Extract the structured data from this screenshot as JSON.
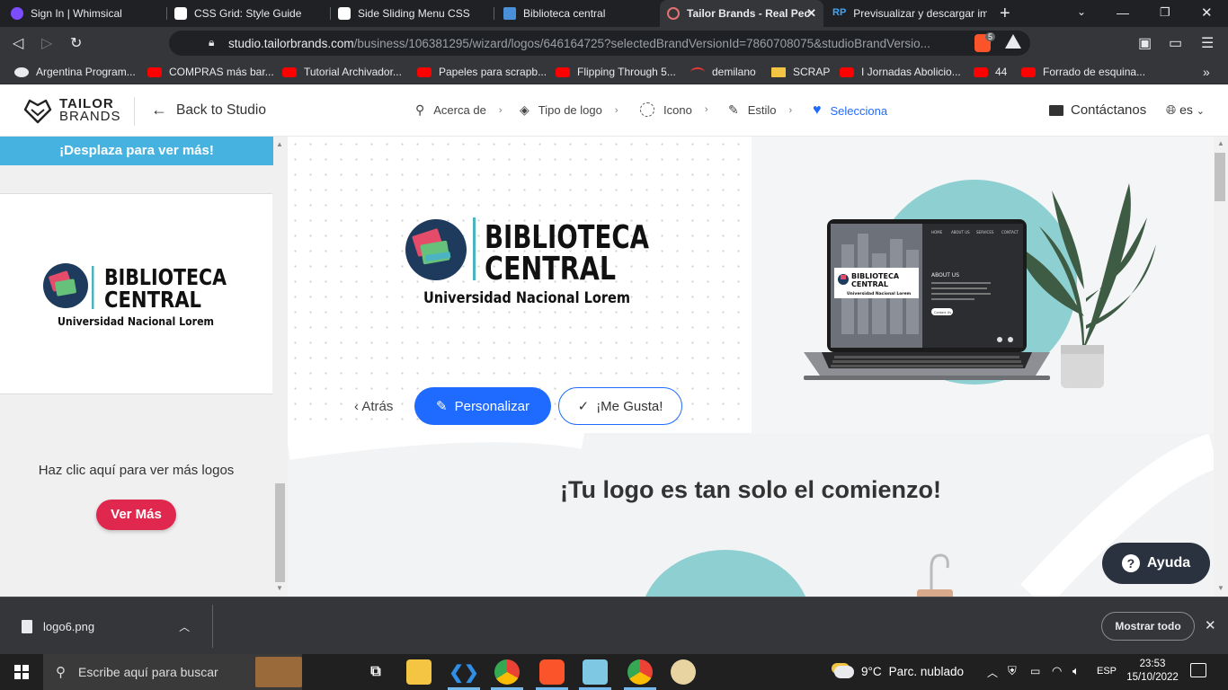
{
  "browser": {
    "tabs": [
      {
        "title": "Sign In | Whimsical",
        "color": "#7c4dff"
      },
      {
        "title": "CSS Grid: Style Guide",
        "color": "#ffffff"
      },
      {
        "title": "Side Sliding Menu CSS",
        "color": "#ffffff"
      },
      {
        "title": "Biblioteca central",
        "color": "#4a90d9"
      },
      {
        "title": "Tailor Brands - Real Pec",
        "color": "#e53935"
      },
      {
        "title": "Previsualizar y descargar im",
        "color": "#42a5f5"
      }
    ],
    "new_tab": "+",
    "url_domain": "studio.tailorbrands.com",
    "url_path": "/business/106381295/wizard/logos/646164725?selectedBrandVersionId=7860708075&studioBrandVersio...",
    "brave_badge": "5",
    "bookmarks": [
      {
        "label": "Argentina Program...",
        "color": "#e8eaed"
      },
      {
        "label": "COMPRAS más bar...",
        "color": "#ff0000"
      },
      {
        "label": "Tutorial Archivador...",
        "color": "#ff0000"
      },
      {
        "label": "Papeles para scrapb...",
        "color": "#ff0000"
      },
      {
        "label": "Flipping Through 5...",
        "color": "#ff0000"
      },
      {
        "label": "demilano",
        "color": "#e53935"
      },
      {
        "label": "SCRAP",
        "color": "#f4c542"
      },
      {
        "label": "I Jornadas Abolicio...",
        "color": "#ff0000"
      },
      {
        "label": "44",
        "color": "#ff0000"
      },
      {
        "label": "Forrado de esquina...",
        "color": "#ff0000"
      }
    ],
    "more_bookmarks": "»"
  },
  "header": {
    "brand_line1": "TAILOR",
    "brand_line2": "BRANDS",
    "back_label": "Back to Studio",
    "steps": [
      {
        "label": "Acerca de"
      },
      {
        "label": "Tipo de logo"
      },
      {
        "label": "Icono"
      },
      {
        "label": "Estilo"
      },
      {
        "label": "Selecciona"
      }
    ],
    "contact_label": "Contáctanos",
    "lang_label": "es"
  },
  "sidebar": {
    "scroll_hint": "¡Desplaza para ver más!",
    "more_logos_text": "Haz clic aquí para ver más logos",
    "ver_mas_label": "Ver Más"
  },
  "logo": {
    "line1": "BIBLIOTECA",
    "line2": "CENTRAL",
    "subtitle": "Universidad Nacional Lorem"
  },
  "mockup": {
    "nav": [
      "HOME",
      "ABOUT US",
      "SERVICES",
      "CONTACT"
    ],
    "section_title": "ABOUT US",
    "button": "Contact Us"
  },
  "main": {
    "atras_label": "Atrás",
    "personalizar_label": "Personalizar",
    "megusta_label": "¡Me Gusta!",
    "tagline": "¡Tu logo es tan solo el comienzo!",
    "ayuda_label": "Ayuda"
  },
  "download": {
    "filename": "logo6.png",
    "show_all": "Mostrar todo"
  },
  "taskbar": {
    "search_placeholder": "Escribe aquí para buscar",
    "weather_temp": "9°C",
    "weather_desc": "Parc. nublado",
    "lang": "ESP",
    "time": "23:53",
    "date": "15/10/2022"
  },
  "colors": {
    "accent_blue": "#1f6bff",
    "ver_mas_red": "#e0284f",
    "scroll_hint_bg": "#45b2e0",
    "logo_teal": "#4bb3c1"
  }
}
